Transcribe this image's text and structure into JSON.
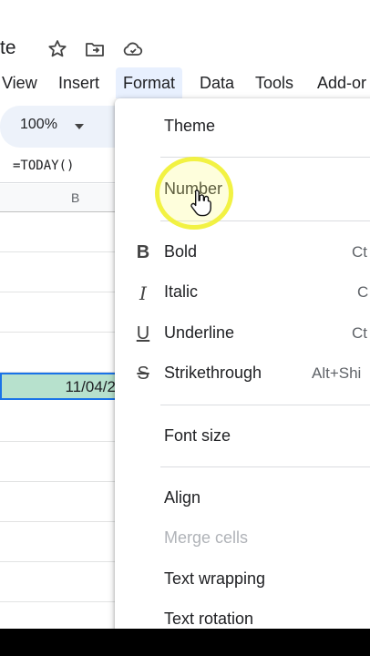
{
  "doc": {
    "title_fragment": "te"
  },
  "menubar": {
    "items": [
      "View",
      "Insert",
      "Format",
      "Data",
      "Tools",
      "Add-or"
    ]
  },
  "toolbar": {
    "zoom": "100%"
  },
  "formula_bar": {
    "text": "=TODAY()"
  },
  "grid": {
    "column_label": "B",
    "selected_cell_value": "11/04/2"
  },
  "format_menu": {
    "theme": "Theme",
    "number": "Number",
    "bold": "Bold",
    "bold_shortcut": "Ct",
    "italic": "Italic",
    "italic_shortcut": "C",
    "underline": "Underline",
    "underline_shortcut": "Ct",
    "strikethrough": "Strikethrough",
    "strikethrough_shortcut": "Alt+Shi",
    "font_size": "Font size",
    "align": "Align",
    "merge_cells": "Merge cells",
    "text_wrapping": "Text wrapping",
    "text_rotation": "Text rotation"
  },
  "icons": {
    "bold": "B",
    "italic": "I",
    "underline": "U",
    "strikethrough": "S"
  }
}
